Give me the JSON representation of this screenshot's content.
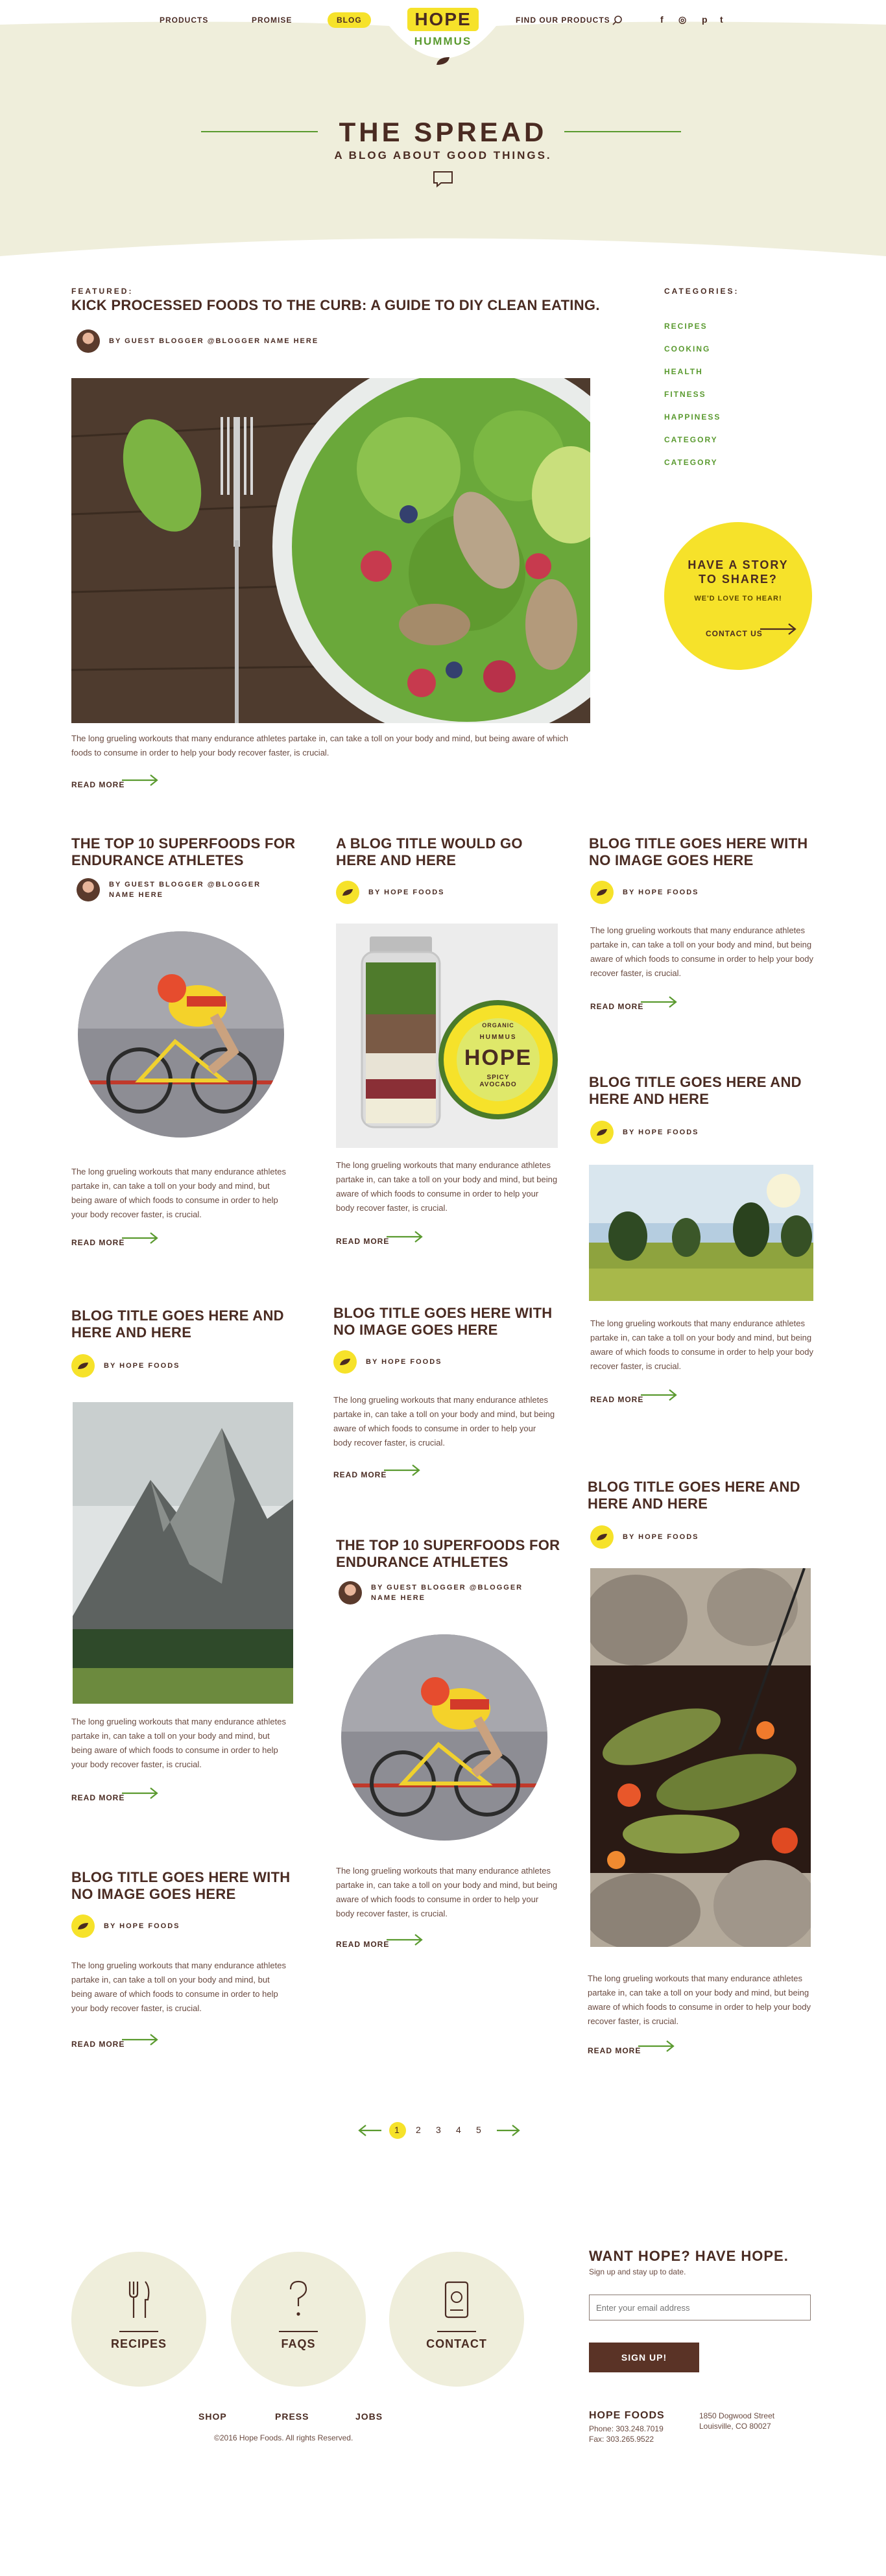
{
  "nav": {
    "products": "PRODUCTS",
    "promise": "PROMISE",
    "blog": "BLOG",
    "find": "FIND OUR PRODUCTS",
    "logo_top": "HOPE",
    "logo_bottom": "HUMMUS",
    "social": [
      "f",
      "◎",
      "p",
      "t"
    ]
  },
  "hero": {
    "title": "THE SPREAD",
    "subtitle": "A BLOG ABOUT GOOD THINGS."
  },
  "featured": {
    "eyebrow": "FEATURED:",
    "title": "KICK PROCESSED FOODS TO THE CURB: A GUIDE TO DIY CLEAN EATING.",
    "author": "BY GUEST BLOGGER @BLOGGER NAME HERE",
    "excerpt": "The long grueling workouts that many endurance athletes partake in, can take a toll on your body and mind, but being aware of which foods to consume in order to help your body recover faster, is crucial.",
    "more": "READ MORE"
  },
  "categories": {
    "heading": "CATEGORIES:",
    "items": [
      "RECIPES",
      "COOKING",
      "HEALTH",
      "FITNESS",
      "HAPPINESS",
      "CATEGORY",
      "CATEGORY"
    ]
  },
  "story": {
    "title1": "HAVE A STORY",
    "title2": "TO SHARE?",
    "sub": "WE'D LOVE TO HEAR!",
    "cta": "CONTACT US"
  },
  "posts": {
    "excerpt": "The long grueling workouts that many endurance athletes partake in, can take a toll on your body and mind, but being aware of which foods to consume in order to help your body recover faster, is crucial.",
    "more": "READ MORE",
    "by_hope": "BY HOPE FOODS",
    "by_guest1": "BY GUEST BLOGGER @BLOGGER",
    "by_guest2": "NAME HERE",
    "t_superfoods1": "THE TOP 10 SUPERFOODS FOR",
    "t_superfoods2": "ENDURANCE ATHLETES",
    "t_would1": "A BLOG TITLE WOULD GO",
    "t_would2": "HERE AND HERE",
    "t_noimg1": "BLOG TITLE GOES HERE WITH",
    "t_noimg2": "NO IMAGE GOES HERE",
    "t_here1": "BLOG TITLE GOES HERE AND",
    "t_here2": "HERE AND HERE",
    "jar_top": "ORGANIC",
    "jar_mid": "HUMMUS",
    "jar_brand": "HOPE",
    "jar_flavor1": "SPICY",
    "jar_flavor2": "AVOCADO"
  },
  "pagination": {
    "pages": [
      "1",
      "2",
      "3",
      "4",
      "5"
    ],
    "current": "1"
  },
  "footer": {
    "recipes": "RECIPES",
    "faqs": "FAQS",
    "contact": "CONTACT",
    "news_title": "WANT HOPE? HAVE HOPE.",
    "news_sub": "Sign up and stay up to date.",
    "email_placeholder": "Enter your email address",
    "signup": "SIGN UP!",
    "shop": "SHOP",
    "press": "PRESS",
    "jobs": "JOBS",
    "copyright": "©2016 Hope Foods. All rights Reserved.",
    "company": "HOPE FOODS",
    "phone": "Phone: 303.248.7019",
    "fax": "Fax: 303.265.9522",
    "addr1": "1850 Dogwood Street",
    "addr2": "Louisville, CO 80027"
  },
  "colors": {
    "brown": "#4a2b22",
    "green": "#5a9a2f",
    "yellow": "#f6e22a",
    "cream": "#efeedb"
  }
}
